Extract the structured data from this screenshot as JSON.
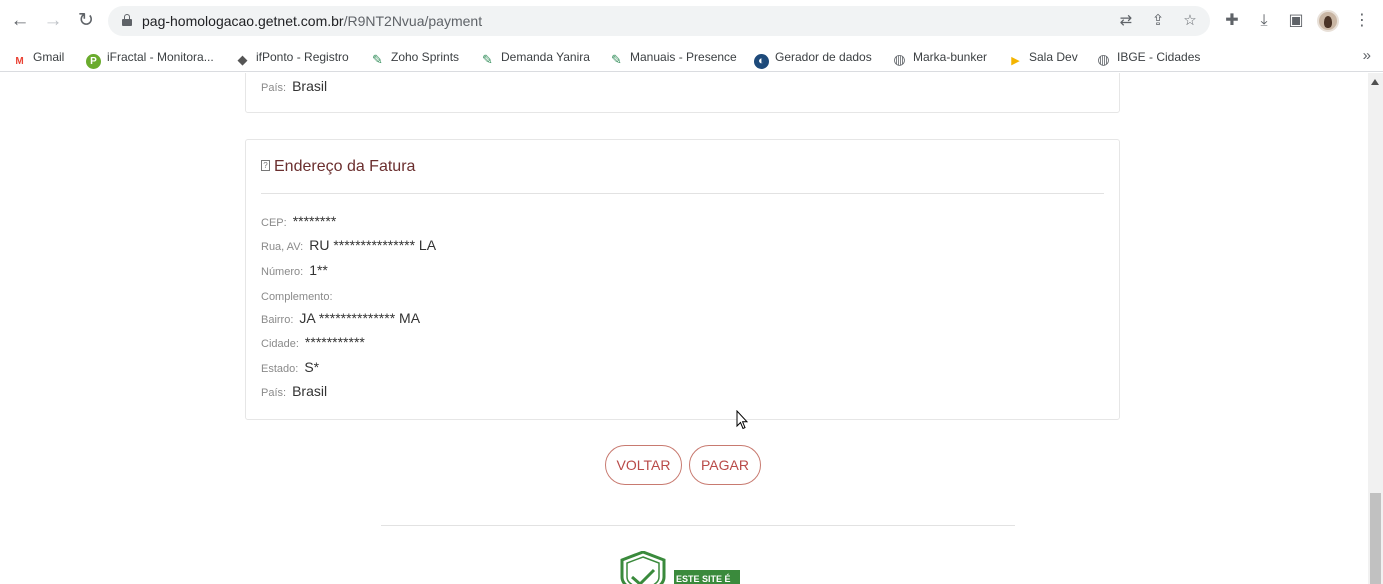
{
  "browser": {
    "url_host": "pag-homologacao.getnet.com.br",
    "url_path": "/R9NT2Nvua/payment"
  },
  "bookmarks": [
    {
      "label": "Gmail",
      "icon": "gmail-icon",
      "color": "#ea4335",
      "glyph": "M"
    },
    {
      "label": "iFractal - Monitora...",
      "icon": "ifractal-icon",
      "color": "#6aab2d",
      "glyph": "P"
    },
    {
      "label": "ifPonto - Registro",
      "icon": "ifponto-icon",
      "color": "#555555",
      "glyph": "◆"
    },
    {
      "label": "Zoho Sprints",
      "icon": "zoho-sprints-icon",
      "color": "#2e8b57",
      "glyph": "✎"
    },
    {
      "label": "Demanda Yanira",
      "icon": "demanda-icon",
      "color": "#2e8b57",
      "glyph": "✎"
    },
    {
      "label": "Manuais - Presence",
      "icon": "manuais-icon",
      "color": "#2e8b57",
      "glyph": "✎"
    },
    {
      "label": "Gerador de dados",
      "icon": "gerador-icon",
      "color": "#1e4a7a",
      "glyph": "◐"
    },
    {
      "label": "Marka-bunker",
      "icon": "globe-icon",
      "color": "#5f6368",
      "glyph": "◍"
    },
    {
      "label": "Sala Dev",
      "icon": "meet-icon",
      "color": "#f4b400",
      "glyph": "▶"
    },
    {
      "label": "IBGE - Cidades",
      "icon": "globe-icon",
      "color": "#5f6368",
      "glyph": "◍"
    }
  ],
  "previous_card": {
    "pais_label": "País:",
    "pais_value": "Brasil"
  },
  "fatura": {
    "title": "Endereço da Fatura",
    "fields": [
      {
        "label": "CEP:",
        "value": "********"
      },
      {
        "label": "Rua, AV:",
        "value": "RU *************** LA"
      },
      {
        "label": "Número:",
        "value": "1**"
      },
      {
        "label": "Complemento:",
        "value": ""
      },
      {
        "label": "Bairro:",
        "value": "JA ************** MA"
      },
      {
        "label": "Cidade:",
        "value": "***********"
      },
      {
        "label": "Estado:",
        "value": "S*"
      },
      {
        "label": "País:",
        "value": "Brasil"
      }
    ]
  },
  "actions": {
    "voltar": "VOLTAR",
    "pagar": "PAGAR"
  },
  "seal": {
    "text": "ESTE SITE É"
  },
  "colors": {
    "accent": "#b94a48",
    "title": "#6b2f2f",
    "seal_green": "#3a8a3c"
  }
}
